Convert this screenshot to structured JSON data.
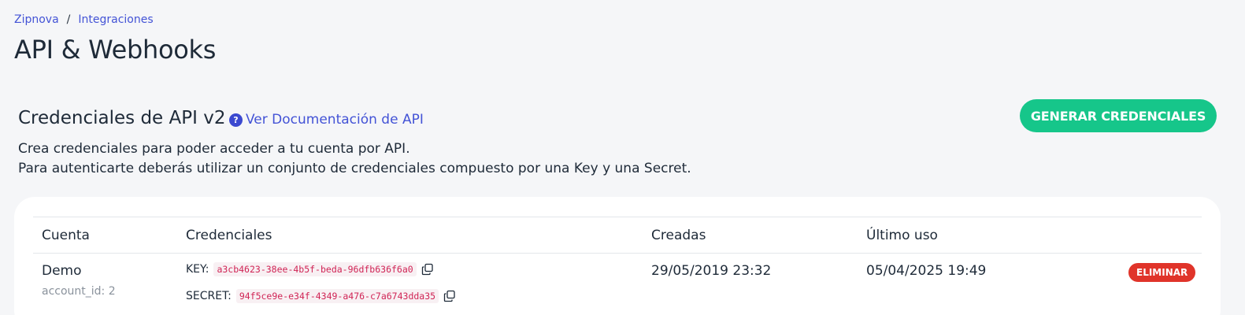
{
  "breadcrumb": {
    "items": [
      "Zipnova",
      "Integraciones"
    ],
    "separator": "/"
  },
  "page_title": "API & Webhooks",
  "section": {
    "title": "Credenciales de API v2",
    "doc_link": "Ver Documentación de API",
    "help_icon_glyph": "?",
    "generate_button": "GENERAR CREDENCIALES",
    "description_line1": "Crea credenciales para poder acceder a tu cuenta por API.",
    "description_line2": "Para autenticarte deberás utilizar un conjunto de credenciales compuesto por una Key y una Secret."
  },
  "table": {
    "headers": {
      "account": "Cuenta",
      "credentials": "Credenciales",
      "created": "Creadas",
      "last_use": "Último uso"
    },
    "rows": [
      {
        "account_name": "Demo",
        "account_id": "account_id: 2",
        "key_label": "KEY:",
        "key_value": "a3cb4623-38ee-4b5f-beda-96dfb636f6a0",
        "secret_label": "SECRET:",
        "secret_value": "94f5ce9e-e34f-4349-a476-c7a6743dda35",
        "created": "29/05/2019 23:32",
        "last_use": "05/04/2025 19:49",
        "delete_label": "ELIMINAR"
      }
    ]
  },
  "colors": {
    "accent": "#4353d6",
    "primary_button": "#16c68a",
    "danger": "#e0342a",
    "code_text": "#d02455"
  },
  "icons": {
    "help": "help-circle-icon",
    "copy": "copy-icon"
  }
}
